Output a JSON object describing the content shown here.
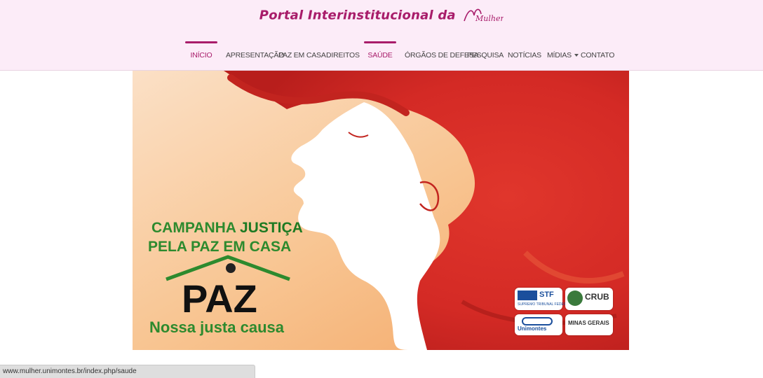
{
  "header": {
    "brand_text": "Portal Interinstitucional da",
    "logo_text": "Mulher"
  },
  "nav": {
    "items": [
      {
        "label": "INÍCIO",
        "active": true
      },
      {
        "label": "APRESENTAÇÃO",
        "active": false
      },
      {
        "label": "PAZ EM CASA",
        "active": false
      },
      {
        "label": "DIREITOS",
        "active": false
      },
      {
        "label": "SAÚDE",
        "active": true
      },
      {
        "label": "ÓRGÃOS DE DEFESA",
        "active": false
      },
      {
        "label": "PESQUISA",
        "active": false
      },
      {
        "label": "NOTÍCIAS",
        "active": false
      },
      {
        "label": "MÍDIAS",
        "active": false,
        "dropdown": true
      },
      {
        "label": "CONTATO",
        "active": false
      }
    ]
  },
  "banner": {
    "campaign_line1_a": "CAMPANHA ",
    "campaign_line1_b": "JUSTIÇA",
    "campaign_line2": "PELA PAZ EM CASA",
    "paz_text": "PAZ",
    "slogan": "Nossa justa causa",
    "partners": {
      "stf": "STF",
      "stf_sub": "SUPREMO TRIBUNAL FEDERAL",
      "crub": "CRUB",
      "unimontes": "Unimontes",
      "minas": "MINAS GERAIS"
    },
    "colors": {
      "red": "#d42a25",
      "green": "#2d8a2e",
      "peach": "#f7c9a0"
    }
  },
  "status_bar": {
    "url": "www.mulher.unimontes.br/index.php/saude"
  }
}
